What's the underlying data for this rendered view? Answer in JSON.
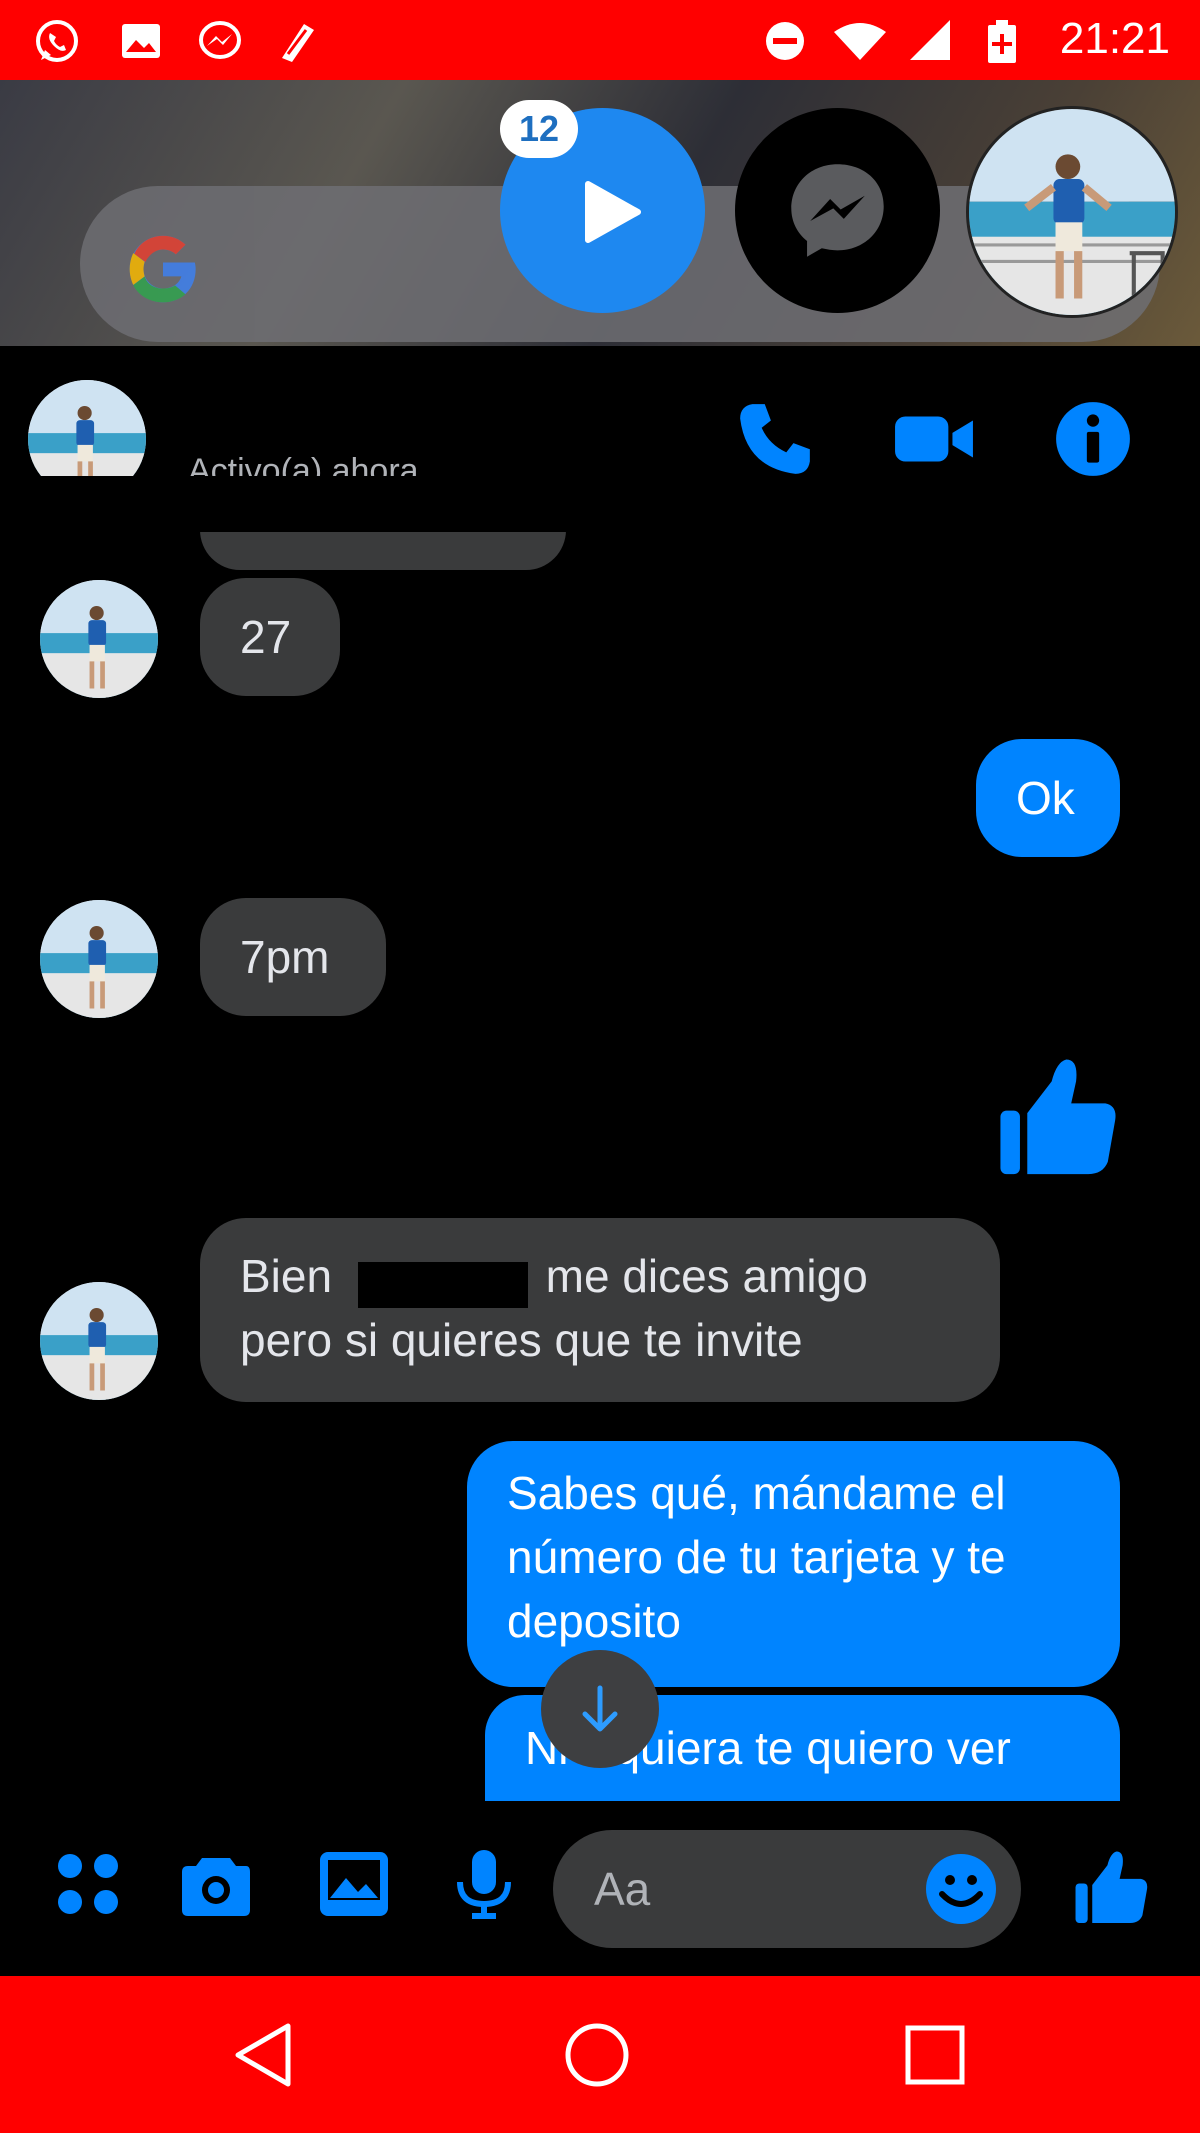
{
  "status_bar": {
    "time": "21:21",
    "left_icons": [
      "whatsapp-icon",
      "gallery-icon",
      "messenger-icon",
      "app-notification-icon"
    ],
    "right_icons": [
      "do-not-disturb-icon",
      "wifi-icon",
      "signal-icon",
      "battery-icon"
    ]
  },
  "chat_heads": {
    "badge_count": "12"
  },
  "chat_header": {
    "status": "Activo(a) ahora"
  },
  "messages": [
    {
      "from": "them",
      "text": "27"
    },
    {
      "from": "me",
      "text": "Ok"
    },
    {
      "from": "them",
      "text": "7pm"
    },
    {
      "from": "me",
      "type": "like"
    },
    {
      "from": "them",
      "line1_start": "Bien",
      "line1_end": "me dices amigo",
      "line2": "pero si quieres que te invite"
    },
    {
      "from": "me",
      "lines": [
        "Sabes qué, mándame el",
        "número de tu tarjeta y te",
        "deposito"
      ]
    },
    {
      "from": "me",
      "text": "Ni siquiera te quiero ver"
    }
  ],
  "composer": {
    "placeholder": "Aa"
  },
  "colors": {
    "accent": "#0084ff",
    "system_bars": "#ff0000",
    "incoming_bubble": "#3a3b3c"
  }
}
